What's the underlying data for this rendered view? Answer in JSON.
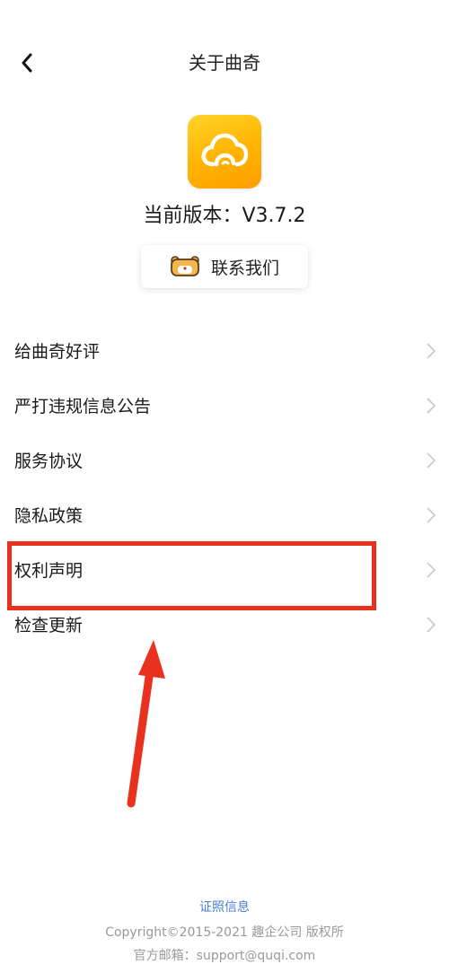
{
  "header": {
    "back_icon": "chevron-left-icon",
    "title": "关于曲奇"
  },
  "app": {
    "logo_icon": "cloud-icon",
    "version_label": "当前版本：V3.7.2"
  },
  "contact_button": {
    "icon": "bear-face-icon",
    "label": "联系我们"
  },
  "menu": {
    "items": [
      {
        "label": "给曲奇好评"
      },
      {
        "label": "严打违规信息公告"
      },
      {
        "label": "服务协议"
      },
      {
        "label": "隐私政策"
      },
      {
        "label": "权利声明"
      },
      {
        "label": "检查更新"
      }
    ],
    "chevron_icon": "chevron-right-icon"
  },
  "annotation": {
    "highlighted_item": "权利声明",
    "color": "#e8321e"
  },
  "footer": {
    "license_link": "证照信息",
    "copyright": "Copyright©2015-2021 趣企公司 版权所",
    "email": "官方邮箱：support@quqi.com"
  },
  "colors": {
    "accent_yellow": "#ffb300",
    "link_blue": "#4a7fd4",
    "text_gray": "#999999"
  }
}
